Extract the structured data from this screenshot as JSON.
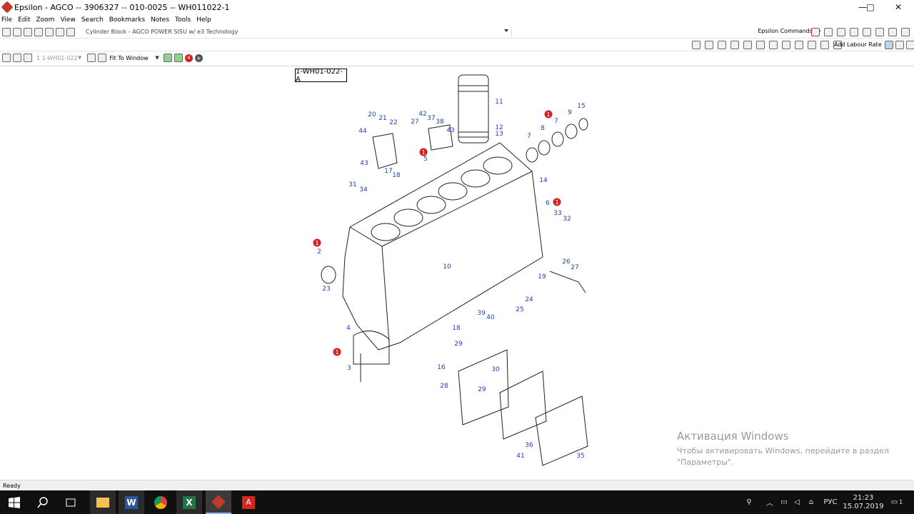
{
  "window": {
    "title": "Epsilon - AGCO -- 3906327 -- 010-0025 -- WH011022-1",
    "controls": [
      "—",
      "□",
      "✕"
    ]
  },
  "menu": [
    "File",
    "Edit",
    "Zoom",
    "View",
    "Search",
    "Bookmarks",
    "Notes",
    "Tools",
    "Help"
  ],
  "toolbar": {
    "document": "Cylinder Block - AGCO POWER SISU w/ e3 Technology",
    "commands_label": "Epsilon Commands ->",
    "add_labour_rate": "Add Labour Rate"
  },
  "view_toolbar": {
    "page": "1 1-WH01-022",
    "zoom": "Fit To Window",
    "note_count": "4"
  },
  "diagram": {
    "figure_label": "1-WH01-022-A",
    "callouts": [
      "1",
      "2",
      "3",
      "4",
      "5",
      "6",
      "7",
      "8",
      "9",
      "10",
      "11",
      "12",
      "13",
      "14",
      "15",
      "16",
      "17",
      "18",
      "19",
      "20",
      "21",
      "22",
      "23",
      "24",
      "25",
      "26",
      "27",
      "28",
      "29",
      "30",
      "31",
      "32",
      "33",
      "34",
      "35",
      "36",
      "37",
      "38",
      "39",
      "40",
      "41",
      "42",
      "43",
      "44"
    ],
    "flag_marker": "1"
  },
  "watermark": {
    "heading": "Активация Windows",
    "line1": "Чтобы активировать Windows, перейдите в раздел",
    "line2": "\"Параметры\"."
  },
  "status": {
    "text": "Ready"
  },
  "taskbar": {
    "language": "РУС",
    "time": "21:23",
    "date": "15.07.2019",
    "notifications": "1"
  },
  "colors": {
    "callout_text": "#1f3fbf",
    "flag": "#d61f1f",
    "taskbar": "#101010"
  }
}
